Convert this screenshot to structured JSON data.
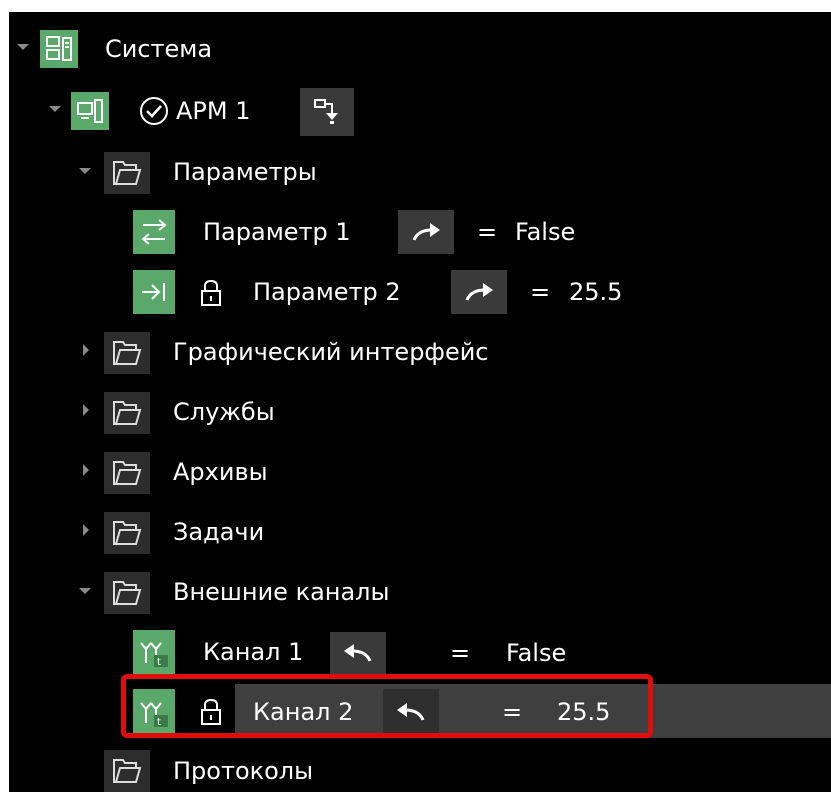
{
  "tree": {
    "root": {
      "label": "Система"
    },
    "arm": {
      "label": "АРМ 1"
    },
    "params": {
      "label": "Параметры"
    },
    "param1": {
      "label": "Параметр 1",
      "eq": "=",
      "value": "False"
    },
    "param2": {
      "label": "Параметр 2",
      "eq": "=",
      "value": "25.5"
    },
    "gui": {
      "label": "Графический интерфейс"
    },
    "services": {
      "label": "Службы"
    },
    "archives": {
      "label": "Архивы"
    },
    "tasks": {
      "label": "Задачи"
    },
    "ext": {
      "label": "Внешние каналы"
    },
    "ch1": {
      "label": "Канал 1",
      "eq": "=",
      "value": "False"
    },
    "ch2": {
      "label": "Канал 2",
      "eq": "=",
      "value": "25.5"
    },
    "protocols": {
      "label": "Протоколы"
    }
  },
  "colors": {
    "green": "#5aa86a",
    "selection_border": "#e00d0d",
    "selection_bg": "#3f3f3f"
  },
  "icons": [
    "system-icon",
    "workstation-icon",
    "checkmark-icon",
    "folder-icon",
    "io-param-icon",
    "input-param-icon",
    "lock-icon",
    "arrow-forward-icon",
    "arrow-back-icon",
    "channel-icon",
    "node-action-icon"
  ]
}
